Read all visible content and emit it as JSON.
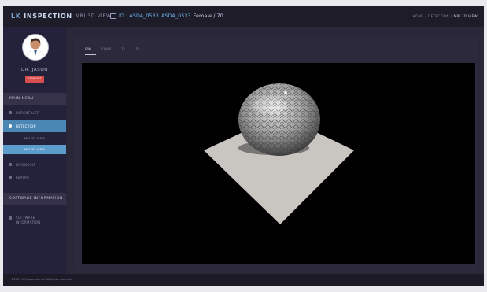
{
  "app": {
    "brand_prefix": "LK",
    "brand_rest": "INSPECTION"
  },
  "header": {
    "page_title": "MRI 3D VIEW",
    "patient_id_text": "ID : ASDA_0533",
    "patient_name": "ASDA_0533",
    "patient_sex_age": "Female / 70",
    "breadcrumb": [
      "HOME",
      "/",
      "DETECTION",
      "/",
      "MRI 3D VIEW"
    ]
  },
  "sidebar": {
    "doctor": "DR. JASON",
    "signout_label": "SIGN OUT",
    "main_menu_label": "MAIN MENU",
    "items": [
      {
        "label": "PATIENT LIST",
        "icon": "user-icon"
      },
      {
        "label": "DETECTION",
        "icon": "circle-icon"
      },
      {
        "label": "MRI 2D VIEW"
      },
      {
        "label": "MRI 3D VIEW"
      },
      {
        "label": "DIAGNOSIS",
        "icon": "chart-icon"
      },
      {
        "label": "REPORT",
        "icon": "report-icon"
      }
    ],
    "software_info_header": "SOFTWARE INFORMATION",
    "software_info_line1": "SOFTWARE",
    "software_info_line2": "INFORMATION"
  },
  "tabs": [
    "DWI",
    "FLAIR",
    "T1",
    "T2"
  ],
  "footer": {
    "copyright": "©2017 LK Inspection Inc All rights reserved."
  },
  "colors": {
    "frame_bg": "#2a2738",
    "sidebar_bg": "#24213a",
    "accent_blue": "#4a87b5",
    "signout_red": "#d84d4d",
    "viewer_bg": "#000000",
    "plane_gray": "#c8c8c8"
  }
}
